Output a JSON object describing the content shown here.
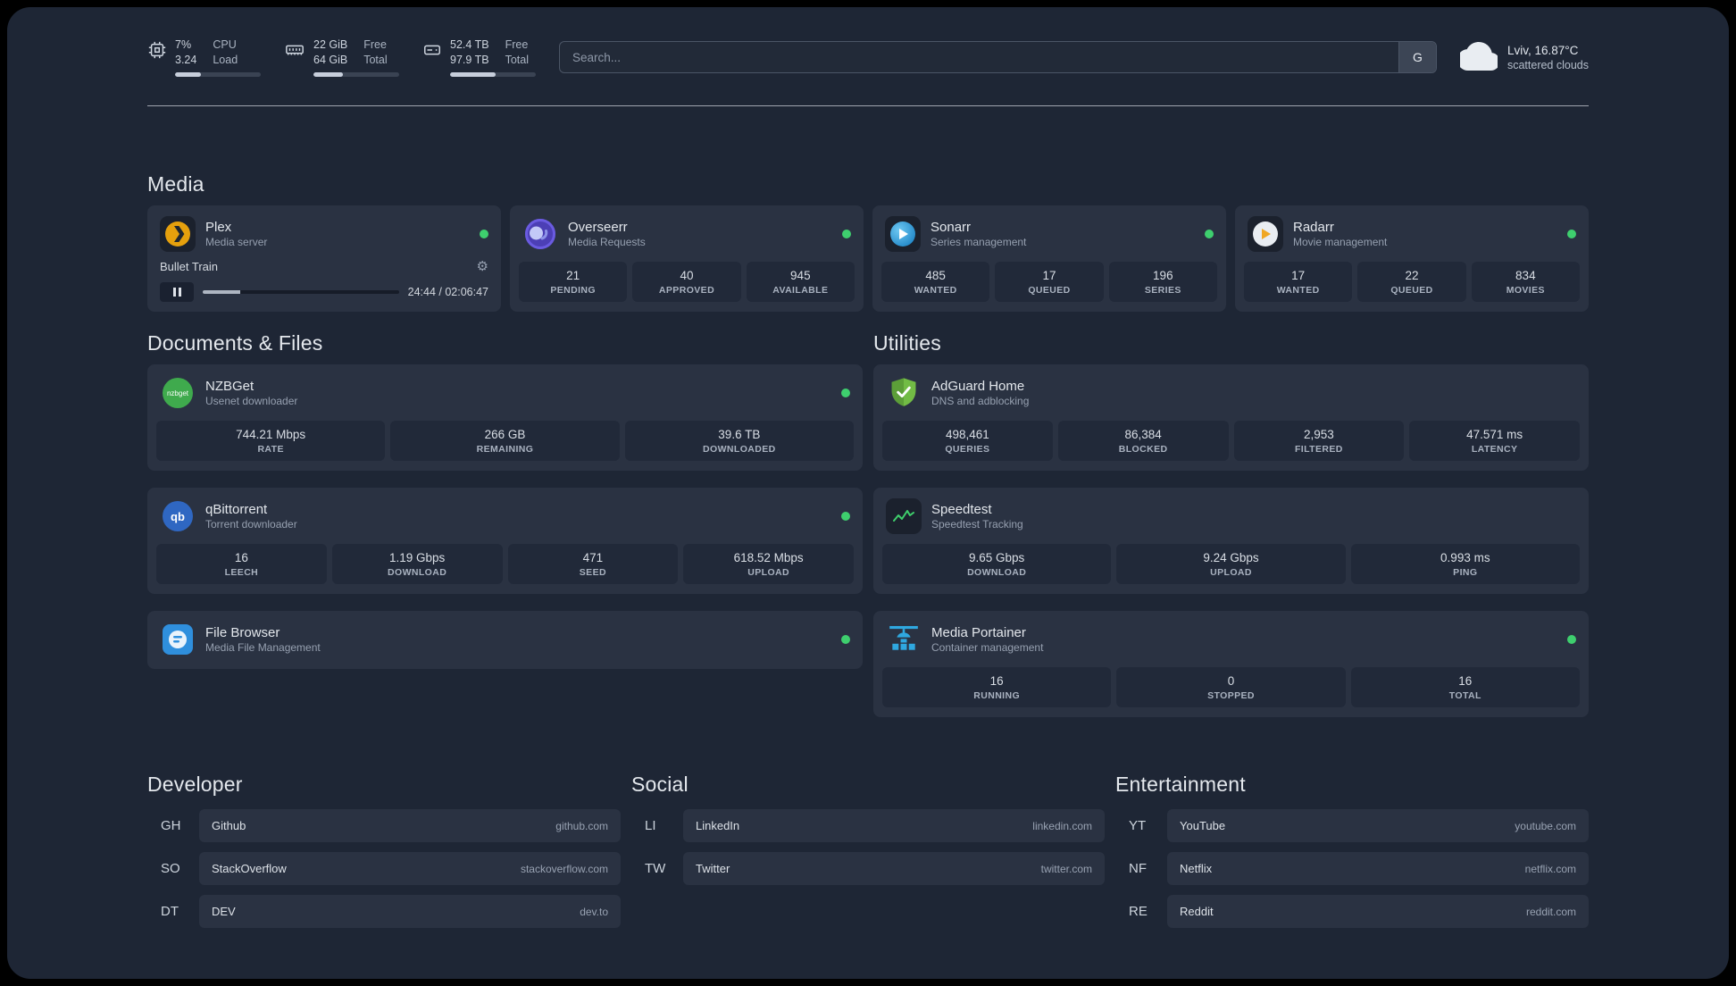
{
  "topbar": {
    "cpu": {
      "value": "7%",
      "secondary": "3.24",
      "label1": "CPU",
      "label2": "Load",
      "bar_pct": 30
    },
    "memory": {
      "value": "22 GiB",
      "secondary": "64 GiB",
      "label1": "Free",
      "label2": "Total",
      "bar_pct": 34
    },
    "disk": {
      "value": "52.4 TB",
      "secondary": "97.9 TB",
      "label1": "Free",
      "label2": "Total",
      "bar_pct": 53
    },
    "search": {
      "placeholder": "Search...",
      "provider_button": "G"
    },
    "weather": {
      "location": "Lviv, 16.87°C",
      "condition": "scattered clouds"
    }
  },
  "media": {
    "title": "Media",
    "plex": {
      "name": "Plex",
      "subtitle": "Media server",
      "now_playing": "Bullet Train",
      "time": "24:44 / 02:06:47",
      "progress_pct": 19
    },
    "overseerr": {
      "name": "Overseerr",
      "subtitle": "Media Requests",
      "stats": [
        {
          "value": "21",
          "label": "PENDING"
        },
        {
          "value": "40",
          "label": "APPROVED"
        },
        {
          "value": "945",
          "label": "AVAILABLE"
        }
      ]
    },
    "sonarr": {
      "name": "Sonarr",
      "subtitle": "Series management",
      "stats": [
        {
          "value": "485",
          "label": "WANTED"
        },
        {
          "value": "17",
          "label": "QUEUED"
        },
        {
          "value": "196",
          "label": "SERIES"
        }
      ]
    },
    "radarr": {
      "name": "Radarr",
      "subtitle": "Movie management",
      "stats": [
        {
          "value": "17",
          "label": "WANTED"
        },
        {
          "value": "22",
          "label": "QUEUED"
        },
        {
          "value": "834",
          "label": "MOVIES"
        }
      ]
    }
  },
  "documents": {
    "title": "Documents & Files",
    "nzbget": {
      "name": "NZBGet",
      "subtitle": "Usenet downloader",
      "stats": [
        {
          "value": "744.21 Mbps",
          "label": "RATE"
        },
        {
          "value": "266 GB",
          "label": "REMAINING"
        },
        {
          "value": "39.6 TB",
          "label": "DOWNLOADED"
        }
      ]
    },
    "qbittorrent": {
      "name": "qBittorrent",
      "subtitle": "Torrent downloader",
      "stats": [
        {
          "value": "16",
          "label": "LEECH"
        },
        {
          "value": "1.19 Gbps",
          "label": "DOWNLOAD"
        },
        {
          "value": "471",
          "label": "SEED"
        },
        {
          "value": "618.52 Mbps",
          "label": "UPLOAD"
        }
      ]
    },
    "filebrowser": {
      "name": "File Browser",
      "subtitle": "Media File Management"
    }
  },
  "utilities": {
    "title": "Utilities",
    "adguard": {
      "name": "AdGuard Home",
      "subtitle": "DNS and adblocking",
      "stats": [
        {
          "value": "498,461",
          "label": "QUERIES"
        },
        {
          "value": "86,384",
          "label": "BLOCKED"
        },
        {
          "value": "2,953",
          "label": "FILTERED"
        },
        {
          "value": "47.571 ms",
          "label": "LATENCY"
        }
      ]
    },
    "speedtest": {
      "name": "Speedtest",
      "subtitle": "Speedtest Tracking",
      "stats": [
        {
          "value": "9.65 Gbps",
          "label": "DOWNLOAD"
        },
        {
          "value": "9.24 Gbps",
          "label": "UPLOAD"
        },
        {
          "value": "0.993 ms",
          "label": "PING"
        }
      ]
    },
    "portainer": {
      "name": "Media Portainer",
      "subtitle": "Container management",
      "stats": [
        {
          "value": "16",
          "label": "RUNNING"
        },
        {
          "value": "0",
          "label": "STOPPED"
        },
        {
          "value": "16",
          "label": "TOTAL"
        }
      ]
    }
  },
  "bookmarks": {
    "developer": {
      "title": "Developer",
      "items": [
        {
          "abbr": "GH",
          "name": "Github",
          "url": "github.com"
        },
        {
          "abbr": "SO",
          "name": "StackOverflow",
          "url": "stackoverflow.com"
        },
        {
          "abbr": "DT",
          "name": "DEV",
          "url": "dev.to"
        }
      ]
    },
    "social": {
      "title": "Social",
      "items": [
        {
          "abbr": "LI",
          "name": "LinkedIn",
          "url": "linkedin.com"
        },
        {
          "abbr": "TW",
          "name": "Twitter",
          "url": "twitter.com"
        }
      ]
    },
    "entertainment": {
      "title": "Entertainment",
      "items": [
        {
          "abbr": "YT",
          "name": "YouTube",
          "url": "youtube.com"
        },
        {
          "abbr": "NF",
          "name": "Netflix",
          "url": "netflix.com"
        },
        {
          "abbr": "RE",
          "name": "Reddit",
          "url": "reddit.com"
        }
      ]
    }
  },
  "colors": {
    "status_online": "#3ecf6e",
    "card": "#2a3242",
    "background": "#1e2635"
  }
}
